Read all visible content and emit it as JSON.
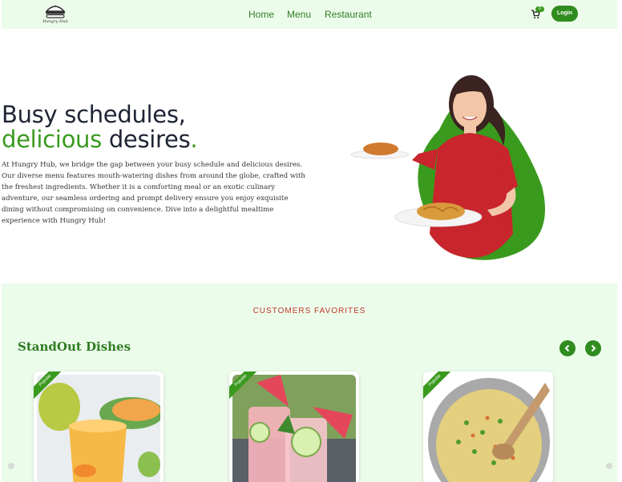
{
  "header": {
    "logo_text": "Hungry Hub",
    "nav": [
      "Home",
      "Menu",
      "Restaurant"
    ],
    "cart_count": "0",
    "login_label": "Login"
  },
  "hero": {
    "title_line1": "Busy schedules,",
    "title_accent": "delicious",
    "title_rest": " desires",
    "title_dot": ".",
    "description": "At Hungry Hub, we bridge the gap between your busy schedule and delicious desires. Our diverse menu features mouth-watering dishes from around the globe, crafted with the freshest ingredients. Whether it is a comforting meal or an exotic culinary adventure, our seamless ordering and prompt delivery ensure you enjoy exquisite dining without compromising on convenience. Dive into a delightful mealtime experience with Hungry Hub!"
  },
  "favorites": {
    "subtitle": "CUSTOMERS FAVORITES",
    "title": "StandOut Dishes",
    "cards": [
      {
        "badge": "Popular"
      },
      {
        "badge": "Popular"
      },
      {
        "badge": "Popular"
      }
    ]
  },
  "colors": {
    "brand_green": "#3a9a1e",
    "dark_green": "#2f8c1f",
    "soft_green_bg": "#ecfceb",
    "title_dark": "#1f2435",
    "subtitle_red": "#c0392b"
  }
}
